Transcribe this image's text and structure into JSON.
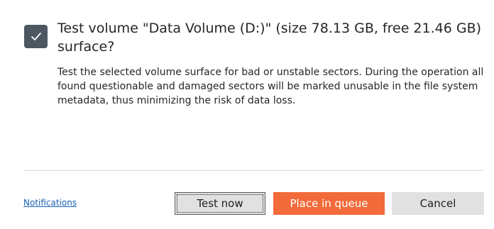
{
  "dialog": {
    "title": "Test volume \"Data Volume (D:)\" (size 78.13 GB, free 21.46 GB) surface?",
    "description": "Test the selected volume surface for bad or unstable sectors. During the operation all found questionable and damaged sectors will be marked unusable in the file system metadata, thus minimizing the risk of data loss.",
    "icon": "checkmark-icon"
  },
  "footer": {
    "notifications_label": "Notifications",
    "test_now_label": "Test now",
    "place_in_queue_label": "Place in queue",
    "cancel_label": "Cancel"
  },
  "colors": {
    "badge": "#4d5761",
    "accent": "#f26b3a",
    "link": "#1a5fb4"
  }
}
